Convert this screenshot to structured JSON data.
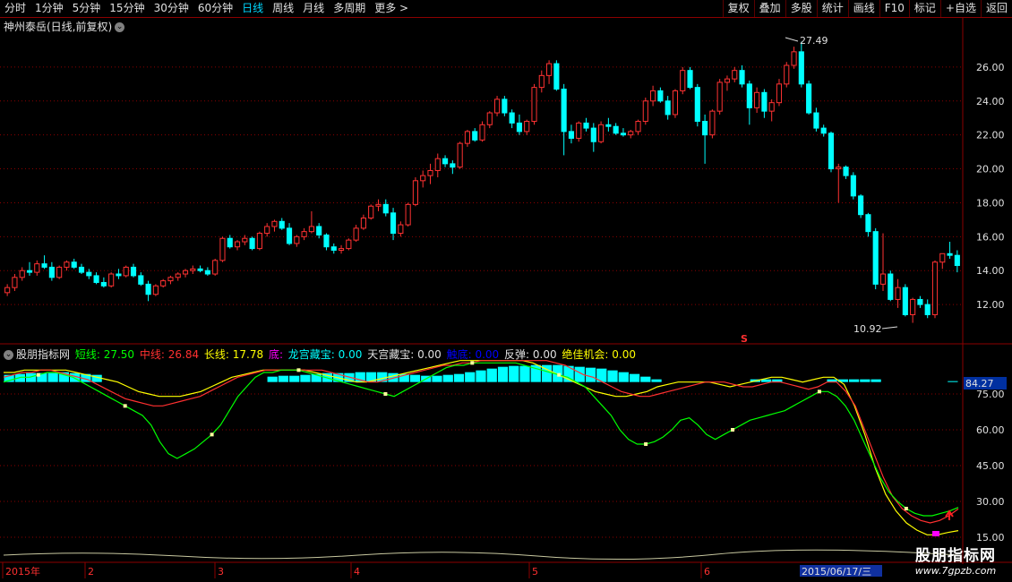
{
  "toolbar": {
    "periods": [
      "分时",
      "1分钟",
      "5分钟",
      "15分钟",
      "30分钟",
      "60分钟",
      "日线",
      "周线",
      "月线",
      "多周期",
      "更多 >"
    ],
    "active_period": "日线",
    "actions": [
      "复权",
      "叠加",
      "多股",
      "统计",
      "画线",
      "F10",
      "标记",
      "+自选",
      "返回"
    ]
  },
  "main": {
    "title": "神州泰岳(日线,前复权)",
    "y_ticks": [
      "26.00",
      "24.00",
      "22.00",
      "20.00",
      "18.00",
      "16.00",
      "14.00",
      "12.00"
    ],
    "high_label": "27.49",
    "low_label": "10.92",
    "signal_mark": "S"
  },
  "indicator": {
    "name": "股朋指标网",
    "items": [
      {
        "label": "短线:",
        "value": "27.50",
        "color": "#00ff00"
      },
      {
        "label": "中线:",
        "value": "26.84",
        "color": "#ff3030"
      },
      {
        "label": "长线:",
        "value": "17.78",
        "color": "#ffff00"
      },
      {
        "label": "底:",
        "value": "",
        "color": "#ff00ff"
      },
      {
        "label": "龙宫藏宝:",
        "value": "0.00",
        "color": "#00ffff"
      },
      {
        "label": "天宫藏宝:",
        "value": "0.00",
        "color": "#e0e0e0"
      },
      {
        "label": "触底:",
        "value": "0.00",
        "color": "#0000ff"
      },
      {
        "label": "反弹:",
        "value": "0.00",
        "color": "#e0e0e0"
      },
      {
        "label": "绝佳机会:",
        "value": "0.00",
        "color": "#ffff00"
      }
    ],
    "y_ticks": [
      "75.00",
      "60.00",
      "45.00",
      "30.00",
      "15.00"
    ],
    "current_tag": "84.27"
  },
  "date_axis": {
    "labels": [
      "2015年",
      "2",
      "3",
      "4",
      "5",
      "6"
    ],
    "current_date": "2015/06/17/三"
  },
  "watermark": {
    "title": "股朋指标网",
    "url": "www.7gpzb.com"
  },
  "colors": {
    "up": "#ff3232",
    "down": "#00ffff",
    "grid": "#8b0000"
  },
  "chart_data": {
    "type": "candlestick",
    "y_range": [
      10,
      28
    ],
    "max": 27.49,
    "min": 10.92,
    "bars": [
      [
        12.7,
        13.2,
        12.5,
        13.0
      ],
      [
        13.0,
        13.8,
        12.8,
        13.6
      ],
      [
        13.6,
        14.2,
        13.4,
        14.0
      ],
      [
        14.0,
        14.5,
        13.7,
        13.9
      ],
      [
        13.9,
        14.6,
        13.7,
        14.4
      ],
      [
        14.4,
        14.9,
        14.1,
        14.2
      ],
      [
        14.2,
        14.5,
        13.4,
        13.6
      ],
      [
        13.6,
        14.3,
        13.5,
        14.2
      ],
      [
        14.2,
        14.6,
        14.0,
        14.5
      ],
      [
        14.5,
        14.7,
        14.1,
        14.2
      ],
      [
        14.2,
        14.4,
        13.8,
        13.9
      ],
      [
        13.9,
        14.1,
        13.5,
        13.7
      ],
      [
        13.7,
        13.9,
        13.2,
        13.3
      ],
      [
        13.3,
        13.6,
        13.0,
        13.1
      ],
      [
        13.1,
        13.9,
        13.0,
        13.8
      ],
      [
        13.8,
        14.1,
        13.5,
        13.7
      ],
      [
        13.7,
        14.3,
        13.6,
        14.2
      ],
      [
        14.2,
        14.4,
        13.6,
        13.7
      ],
      [
        13.7,
        13.9,
        13.1,
        13.2
      ],
      [
        13.2,
        13.4,
        12.2,
        12.6
      ],
      [
        12.6,
        13.2,
        12.5,
        13.1
      ],
      [
        13.1,
        13.5,
        13.0,
        13.4
      ],
      [
        13.4,
        13.7,
        13.2,
        13.6
      ],
      [
        13.6,
        13.9,
        13.4,
        13.8
      ],
      [
        13.8,
        14.1,
        13.6,
        14.0
      ],
      [
        14.0,
        14.3,
        13.8,
        14.1
      ],
      [
        14.1,
        14.3,
        13.9,
        14.0
      ],
      [
        14.0,
        14.2,
        13.7,
        13.8
      ],
      [
        13.8,
        14.7,
        13.7,
        14.6
      ],
      [
        14.6,
        16.0,
        14.5,
        15.9
      ],
      [
        15.9,
        16.1,
        15.3,
        15.4
      ],
      [
        15.4,
        15.8,
        15.2,
        15.7
      ],
      [
        15.7,
        16.1,
        15.5,
        15.9
      ],
      [
        15.9,
        16.0,
        15.2,
        15.3
      ],
      [
        15.3,
        16.3,
        15.2,
        16.2
      ],
      [
        16.2,
        16.8,
        16.0,
        16.6
      ],
      [
        16.6,
        17.0,
        16.3,
        16.9
      ],
      [
        16.9,
        17.1,
        16.4,
        16.5
      ],
      [
        16.5,
        16.8,
        15.5,
        15.6
      ],
      [
        15.6,
        16.1,
        15.4,
        16.0
      ],
      [
        16.0,
        16.5,
        15.8,
        16.3
      ],
      [
        16.3,
        17.5,
        16.2,
        16.6
      ],
      [
        16.6,
        16.8,
        15.9,
        16.1
      ],
      [
        16.1,
        16.2,
        15.2,
        15.4
      ],
      [
        15.4,
        15.6,
        15.0,
        15.2
      ],
      [
        15.2,
        15.5,
        15.0,
        15.3
      ],
      [
        15.3,
        15.9,
        15.2,
        15.8
      ],
      [
        15.8,
        16.7,
        15.7,
        16.5
      ],
      [
        16.5,
        17.3,
        16.4,
        17.1
      ],
      [
        17.1,
        17.9,
        17.0,
        17.8
      ],
      [
        17.8,
        18.2,
        17.5,
        17.9
      ],
      [
        17.9,
        18.2,
        17.2,
        17.4
      ],
      [
        17.4,
        17.7,
        15.8,
        16.2
      ],
      [
        16.2,
        16.9,
        16.0,
        16.7
      ],
      [
        16.7,
        18.0,
        16.6,
        17.9
      ],
      [
        17.9,
        19.5,
        17.8,
        19.3
      ],
      [
        19.3,
        19.9,
        18.9,
        19.6
      ],
      [
        19.6,
        20.3,
        19.1,
        19.9
      ],
      [
        19.9,
        20.9,
        19.5,
        20.6
      ],
      [
        20.6,
        20.8,
        20.1,
        20.3
      ],
      [
        20.3,
        20.5,
        19.7,
        20.1
      ],
      [
        20.1,
        21.6,
        20.0,
        21.5
      ],
      [
        21.5,
        22.3,
        21.3,
        22.2
      ],
      [
        22.2,
        22.4,
        21.6,
        21.7
      ],
      [
        21.7,
        22.8,
        21.6,
        22.6
      ],
      [
        22.6,
        23.4,
        22.4,
        23.3
      ],
      [
        23.3,
        24.3,
        23.1,
        24.1
      ],
      [
        24.1,
        24.3,
        23.1,
        23.3
      ],
      [
        23.3,
        23.5,
        22.4,
        22.7
      ],
      [
        22.7,
        23.2,
        22.0,
        22.2
      ],
      [
        22.2,
        22.9,
        22.0,
        22.8
      ],
      [
        22.8,
        25.0,
        22.6,
        24.8
      ],
      [
        24.8,
        25.8,
        24.5,
        25.5
      ],
      [
        25.5,
        26.4,
        25.0,
        26.2
      ],
      [
        26.2,
        26.4,
        24.6,
        24.7
      ],
      [
        24.7,
        25.0,
        20.8,
        22.2
      ],
      [
        22.2,
        22.6,
        21.5,
        21.8
      ],
      [
        21.8,
        22.8,
        21.6,
        22.7
      ],
      [
        22.7,
        23.0,
        22.2,
        22.4
      ],
      [
        22.4,
        22.7,
        21.0,
        21.6
      ],
      [
        21.6,
        22.8,
        21.5,
        22.6
      ],
      [
        22.6,
        23.0,
        22.2,
        22.5
      ],
      [
        22.5,
        22.7,
        22.0,
        22.1
      ],
      [
        22.1,
        22.4,
        21.9,
        22.0
      ],
      [
        22.0,
        22.3,
        21.8,
        22.2
      ],
      [
        22.2,
        22.9,
        22.0,
        22.8
      ],
      [
        22.8,
        24.2,
        22.6,
        24.0
      ],
      [
        24.0,
        24.9,
        23.7,
        24.6
      ],
      [
        24.6,
        24.8,
        23.9,
        24.0
      ],
      [
        24.0,
        24.3,
        22.9,
        23.2
      ],
      [
        23.2,
        24.7,
        23.0,
        24.6
      ],
      [
        24.6,
        26.0,
        24.4,
        25.8
      ],
      [
        25.8,
        26.0,
        24.7,
        24.8
      ],
      [
        24.8,
        25.0,
        22.5,
        22.8
      ],
      [
        22.8,
        23.2,
        20.3,
        22.0
      ],
      [
        22.0,
        23.5,
        21.8,
        23.4
      ],
      [
        23.4,
        25.3,
        23.2,
        25.1
      ],
      [
        25.1,
        25.5,
        24.6,
        25.3
      ],
      [
        25.3,
        26.0,
        25.1,
        25.8
      ],
      [
        25.8,
        26.1,
        24.8,
        25.0
      ],
      [
        25.0,
        25.2,
        22.6,
        23.6
      ],
      [
        23.6,
        24.8,
        23.3,
        24.5
      ],
      [
        24.5,
        24.7,
        23.0,
        23.4
      ],
      [
        23.4,
        24.1,
        22.8,
        23.9
      ],
      [
        23.9,
        25.3,
        23.7,
        25.0
      ],
      [
        25.0,
        26.3,
        24.8,
        26.1
      ],
      [
        26.1,
        27.2,
        25.9,
        26.9
      ],
      [
        26.9,
        27.49,
        24.8,
        25.0
      ],
      [
        25.0,
        25.2,
        23.2,
        23.3
      ],
      [
        23.3,
        23.6,
        22.2,
        22.4
      ],
      [
        22.4,
        22.6,
        21.9,
        22.1
      ],
      [
        22.1,
        22.2,
        19.8,
        20.0
      ],
      [
        20.0,
        20.3,
        18.0,
        20.1
      ],
      [
        20.1,
        20.2,
        19.4,
        19.6
      ],
      [
        19.6,
        19.8,
        18.2,
        18.4
      ],
      [
        18.4,
        18.5,
        17.1,
        17.3
      ],
      [
        17.3,
        17.4,
        16.0,
        16.3
      ],
      [
        16.3,
        16.5,
        12.9,
        13.2
      ],
      [
        13.2,
        16.2,
        12.8,
        13.8
      ],
      [
        13.8,
        14.0,
        12.2,
        12.3
      ],
      [
        12.3,
        13.5,
        11.8,
        13.0
      ],
      [
        13.0,
        13.2,
        11.3,
        11.4
      ],
      [
        11.4,
        12.4,
        10.92,
        12.3
      ],
      [
        12.3,
        12.5,
        11.8,
        12.0
      ],
      [
        12.0,
        12.3,
        11.2,
        11.4
      ],
      [
        11.4,
        14.6,
        11.2,
        14.5
      ],
      [
        14.5,
        15.0,
        14.1,
        15.0
      ],
      [
        15.0,
        15.7,
        14.7,
        14.9
      ],
      [
        14.9,
        15.2,
        13.9,
        14.3
      ]
    ],
    "indicator_range": [
      15,
      90
    ],
    "short_line": [
      80,
      81,
      82,
      82,
      83,
      84,
      84,
      83,
      82,
      80,
      78,
      76,
      74,
      72,
      70,
      68,
      66,
      62,
      55,
      50,
      48,
      50,
      52,
      55,
      58,
      62,
      68,
      74,
      78,
      82,
      84,
      84,
      85,
      85,
      85,
      84,
      83,
      82,
      81,
      80,
      79,
      78,
      77,
      76,
      75,
      74,
      76,
      78,
      80,
      82,
      84,
      86,
      87,
      87,
      88,
      88,
      88,
      88,
      88,
      88,
      87,
      86,
      85,
      84,
      83,
      82,
      80,
      78,
      74,
      70,
      66,
      60,
      56,
      54,
      54,
      55,
      57,
      60,
      64,
      65,
      62,
      58,
      56,
      58,
      60,
      62,
      64,
      65,
      66,
      67,
      68,
      70,
      72,
      74,
      76,
      76,
      74,
      70,
      64,
      56,
      48,
      40,
      34,
      30,
      27,
      25,
      24,
      24,
      25,
      26,
      27.5
    ],
    "mid_line": [
      82,
      83,
      84,
      84,
      85,
      85,
      84,
      83,
      82,
      81,
      79,
      77,
      75,
      73,
      72,
      71,
      70,
      70,
      71,
      72,
      73,
      74,
      76,
      78,
      80,
      82,
      83,
      84,
      85,
      85,
      85,
      85,
      85,
      85,
      85,
      84,
      83,
      82,
      81,
      80,
      80,
      81,
      82,
      83,
      84,
      85,
      86,
      87,
      87,
      88,
      88,
      89,
      89,
      89,
      89,
      89,
      89,
      89,
      89,
      88,
      87,
      85,
      83,
      82,
      80,
      78,
      76,
      75,
      74,
      74,
      75,
      76,
      77,
      78,
      79,
      80,
      80,
      80,
      79,
      78,
      78,
      79,
      80,
      80,
      79,
      78,
      77,
      78,
      80,
      80,
      76,
      70,
      60,
      50,
      40,
      32,
      27,
      24,
      22,
      21,
      22,
      24,
      26.84
    ],
    "long_line": [
      84,
      84,
      85,
      85,
      85,
      85,
      85,
      84,
      83,
      82,
      81,
      80,
      78,
      76,
      75,
      74,
      74,
      74,
      75,
      76,
      78,
      80,
      82,
      83,
      84,
      85,
      85,
      85,
      85,
      85,
      84,
      83,
      82,
      81,
      80,
      80,
      81,
      82,
      83,
      84,
      85,
      86,
      87,
      88,
      89,
      89,
      89,
      89,
      89,
      89,
      89,
      88,
      86,
      84,
      82,
      80,
      78,
      76,
      75,
      74,
      74,
      75,
      76,
      78,
      79,
      80,
      80,
      80,
      80,
      79,
      78,
      79,
      80,
      81,
      82,
      82,
      81,
      80,
      81,
      82,
      82,
      79,
      70,
      58,
      44,
      33,
      26,
      21,
      18,
      16,
      16,
      17,
      17.78
    ],
    "bar_heights": [
      8,
      9,
      10,
      10,
      10,
      11,
      10,
      9,
      8,
      0,
      0,
      0,
      0,
      0,
      0,
      0,
      0,
      0,
      0,
      0,
      0,
      0,
      0,
      0,
      6,
      7,
      7,
      8,
      9,
      10,
      10,
      10,
      11,
      11,
      11,
      10,
      9,
      8,
      7,
      7,
      8,
      9,
      11,
      13,
      15,
      17,
      18,
      18,
      19,
      19,
      19,
      18,
      17,
      16,
      15,
      13,
      11,
      9,
      6,
      3,
      0,
      0,
      0,
      0,
      0,
      0,
      0,
      0,
      3,
      3,
      3,
      0,
      0,
      0,
      0,
      3,
      3,
      3,
      3,
      3,
      0,
      0,
      0,
      0,
      0,
      0,
      1
    ]
  }
}
